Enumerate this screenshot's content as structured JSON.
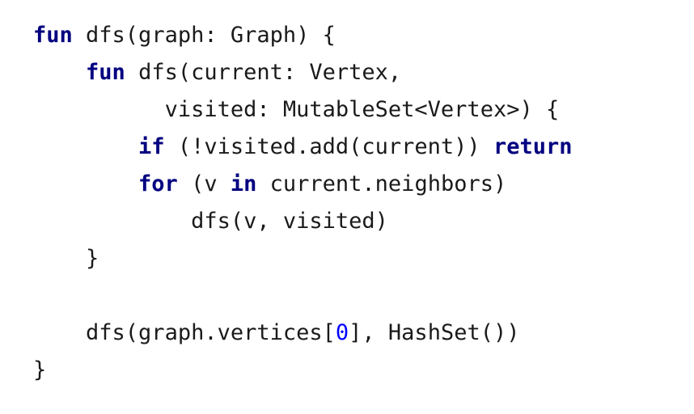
{
  "code": {
    "language": "Kotlin",
    "colors": {
      "background": "#ffffff",
      "text": "#1a1a1a",
      "keyword": "#000080",
      "number": "#0000ff"
    },
    "lines": [
      {
        "indent": "",
        "tokens": [
          {
            "type": "keyword",
            "text": "fun"
          },
          {
            "type": "plain",
            "text": " dfs(graph: Graph) {"
          }
        ]
      },
      {
        "indent": "    ",
        "tokens": [
          {
            "type": "keyword",
            "text": "fun"
          },
          {
            "type": "plain",
            "text": " dfs(current: Vertex,"
          }
        ]
      },
      {
        "indent": "          ",
        "tokens": [
          {
            "type": "plain",
            "text": "visited: MutableSet<Vertex>) {"
          }
        ]
      },
      {
        "indent": "        ",
        "tokens": [
          {
            "type": "keyword",
            "text": "if"
          },
          {
            "type": "plain",
            "text": " (!visited.add(current)) "
          },
          {
            "type": "keyword",
            "text": "return"
          }
        ]
      },
      {
        "indent": "        ",
        "tokens": [
          {
            "type": "keyword",
            "text": "for"
          },
          {
            "type": "plain",
            "text": " (v "
          },
          {
            "type": "keyword",
            "text": "in"
          },
          {
            "type": "plain",
            "text": " current.neighbors)"
          }
        ]
      },
      {
        "indent": "            ",
        "tokens": [
          {
            "type": "plain",
            "text": "dfs(v, visited)"
          }
        ]
      },
      {
        "indent": "    ",
        "tokens": [
          {
            "type": "plain",
            "text": "}"
          }
        ]
      },
      {
        "indent": "",
        "tokens": []
      },
      {
        "indent": "    ",
        "tokens": [
          {
            "type": "plain",
            "text": "dfs(graph.vertices["
          },
          {
            "type": "number",
            "text": "0"
          },
          {
            "type": "plain",
            "text": "], HashSet())"
          }
        ]
      },
      {
        "indent": "",
        "tokens": [
          {
            "type": "plain",
            "text": "}"
          }
        ]
      }
    ]
  }
}
